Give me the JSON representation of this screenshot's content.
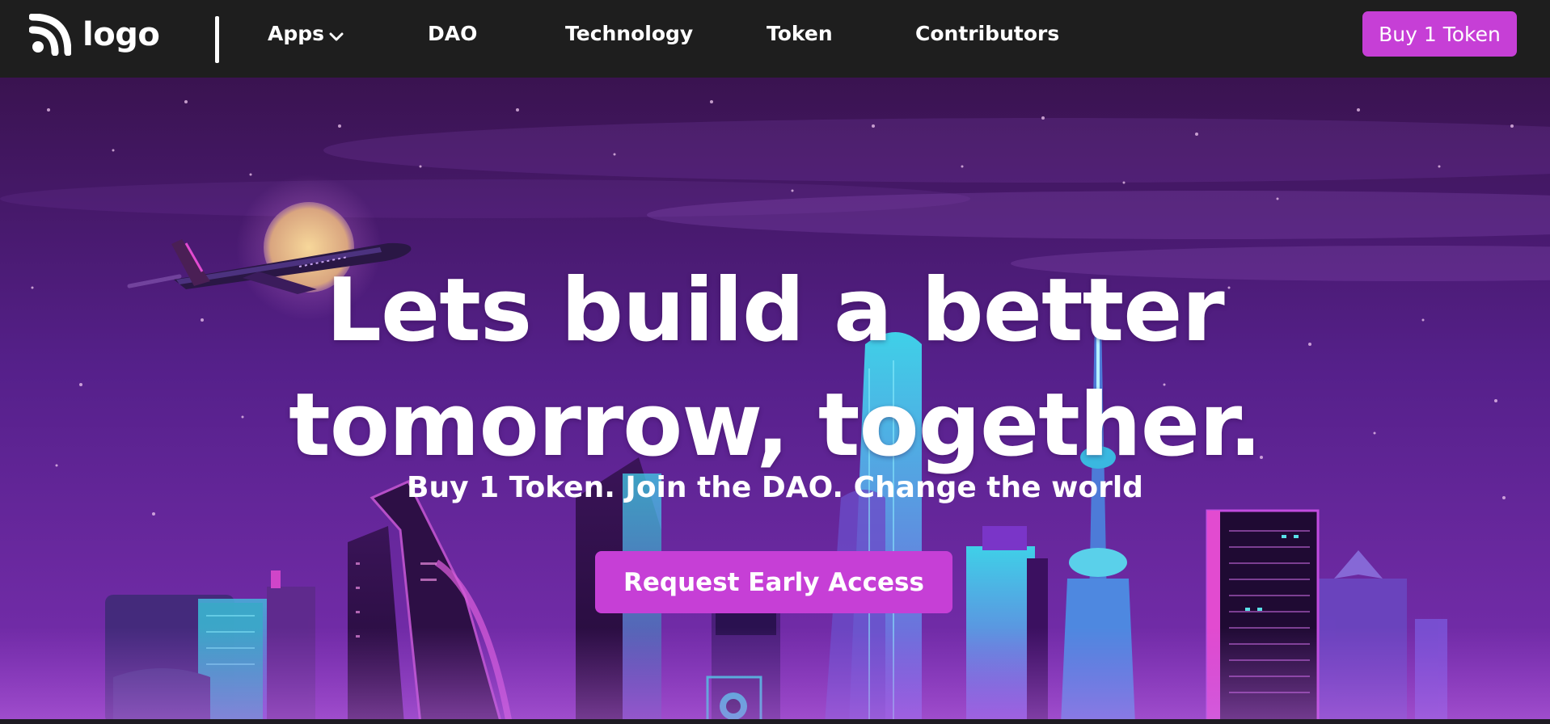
{
  "nav": {
    "logo_text": "logo",
    "items": [
      {
        "label": "Apps",
        "has_dropdown": true
      },
      {
        "label": "DAO"
      },
      {
        "label": "Technology"
      },
      {
        "label": "Token"
      },
      {
        "label": "Contributors"
      }
    ],
    "cta_label": "Buy 1 Token"
  },
  "hero": {
    "title_line1": "Lets build a better",
    "title_line2": "tomorrow, together.",
    "subtitle": "Buy 1 Token. Join the DAO. Change the world",
    "cta_label": "Request Early Access"
  },
  "colors": {
    "navbar_bg": "#1e1e1e",
    "accent": "#c63fd6",
    "hero_sky_top": "#3a1350",
    "hero_sky_bottom": "#7a2fb0",
    "text": "#ffffff"
  },
  "icons": {
    "logo": "wifi-arcs-icon",
    "apps_dropdown": "chevron-down-icon"
  }
}
